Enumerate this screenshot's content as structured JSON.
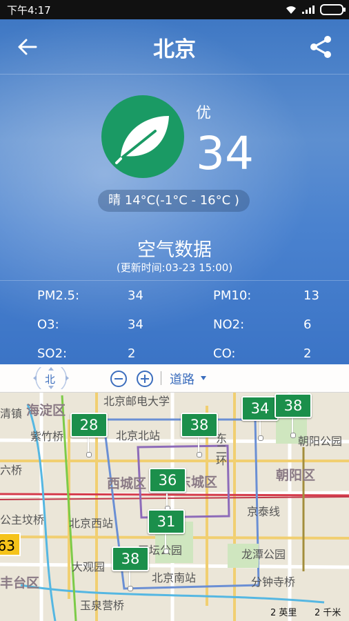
{
  "status_bar": {
    "time": "下午4:17"
  },
  "header": {
    "title": "北京"
  },
  "aqi": {
    "level": "优",
    "value": "34",
    "icon": "leaf-icon",
    "circle_color": "#1a9a64"
  },
  "weather": "晴 14°C(-1°C - 16°C )",
  "air_data": {
    "title": "空气数据",
    "updated": "(更新时间:03-23 15:00)",
    "rows": [
      {
        "label1": "PM2.5:",
        "value1": "34",
        "label2": "PM10:",
        "value2": "13"
      },
      {
        "label1": "O3:",
        "value1": "34",
        "label2": "NO2:",
        "value2": "6"
      },
      {
        "label1": "SO2:",
        "value1": "2",
        "label2": "CO:",
        "value2": "2"
      }
    ]
  },
  "map": {
    "compass_label": "北",
    "road_type": "道路",
    "districts": [
      "海淀区",
      "西城区",
      "东城区",
      "朝阳区",
      "丰台区"
    ],
    "places": [
      "北京邮电大学",
      "北京北站",
      "紫竹桥",
      "朝阳公园",
      "北京西站",
      "京泰线",
      "天坛公园",
      "龙潭公园",
      "大观园",
      "北京南站",
      "分钟寺桥",
      "玉泉营桥",
      "东二环",
      "清镇",
      "六桥",
      "公主坟桥"
    ],
    "markers": [
      "28",
      "38",
      "34",
      "38",
      "36",
      "31",
      "38",
      "63"
    ],
    "scale_imperial": "2 英里",
    "scale_metric": "2 千米"
  }
}
